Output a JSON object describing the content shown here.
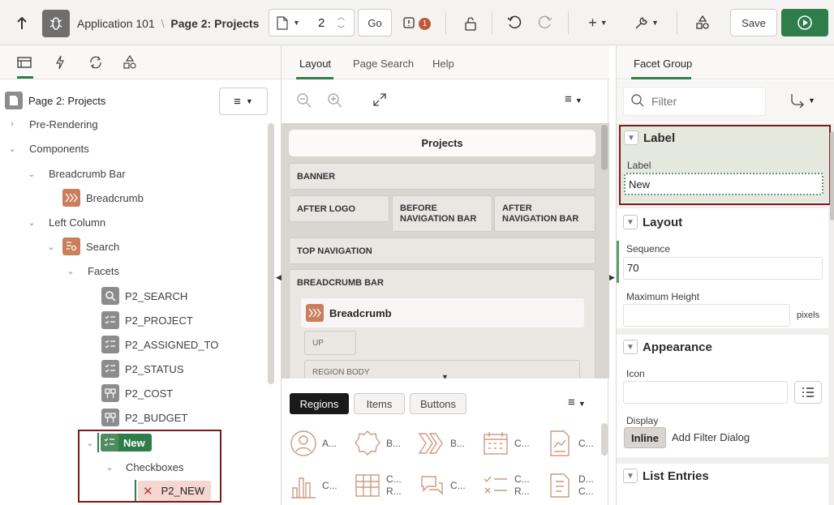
{
  "toolbar": {
    "app_name": "Application 101",
    "separator": "\\",
    "page_name": "Page 2: Projects",
    "page_number": "2",
    "go_label": "Go",
    "issues_count": "1",
    "save_label": "Save"
  },
  "left": {
    "tabs": [
      "rendering-icon",
      "dynamic-actions-icon",
      "processing-icon",
      "shared-components-icon"
    ],
    "root_label": "Page 2: Projects",
    "tree": {
      "pre_rendering": "Pre-Rendering",
      "components": "Components",
      "breadcrumb_bar": "Breadcrumb Bar",
      "breadcrumb": "Breadcrumb",
      "left_column": "Left Column",
      "search": "Search",
      "facets": "Facets",
      "facet_items": [
        "P2_SEARCH",
        "P2_PROJECT",
        "P2_ASSIGNED_TO",
        "P2_STATUS",
        "P2_COST",
        "P2_BUDGET"
      ],
      "new_group": "New",
      "checkboxes": "Checkboxes",
      "p2_new": "P2_NEW"
    }
  },
  "middle": {
    "tabs": [
      "Layout",
      "Page Search",
      "Help"
    ],
    "active_tab": "Layout",
    "layout": {
      "page_title": "Projects",
      "banner": "BANNER",
      "after_logo": "AFTER LOGO",
      "before_nav": "BEFORE NAVIGATION BAR",
      "after_nav": "AFTER NAVIGATION BAR",
      "top_nav": "TOP NAVIGATION",
      "breadcrumb_bar": "BREADCRUMB BAR",
      "breadcrumb_region": "Breadcrumb",
      "up": "UP",
      "region_body": "REGION BODY"
    },
    "gallery_tabs": [
      "Regions",
      "Items",
      "Buttons"
    ],
    "gallery_active": "Regions",
    "gallery_row1": [
      "A...",
      "B...",
      "B...",
      "C...",
      "C..."
    ],
    "gallery_row2_line1": [
      "C...",
      "",
      "C...",
      "C...",
      "C...",
      "D..."
    ],
    "gallery_row2_line2": [
      "",
      "",
      "R...",
      "",
      "R...",
      "C..."
    ]
  },
  "right": {
    "tab": "Facet Group",
    "filter_placeholder": "Filter",
    "label_section": "Label",
    "label_field": "Label",
    "label_value": "New",
    "layout_section": "Layout",
    "sequence_label": "Sequence",
    "sequence_value": "70",
    "max_height_label": "Maximum Height",
    "max_height_unit": "pixels",
    "appearance_section": "Appearance",
    "icon_label": "Icon",
    "display_label": "Display",
    "display_options": [
      "Inline",
      "Add Filter Dialog"
    ],
    "list_entries_section": "List Entries"
  },
  "colors": {
    "accent_green": "#2e7d4a",
    "highlight_border": "#7a1a1a",
    "section_highlight": "#e4e8dd"
  }
}
